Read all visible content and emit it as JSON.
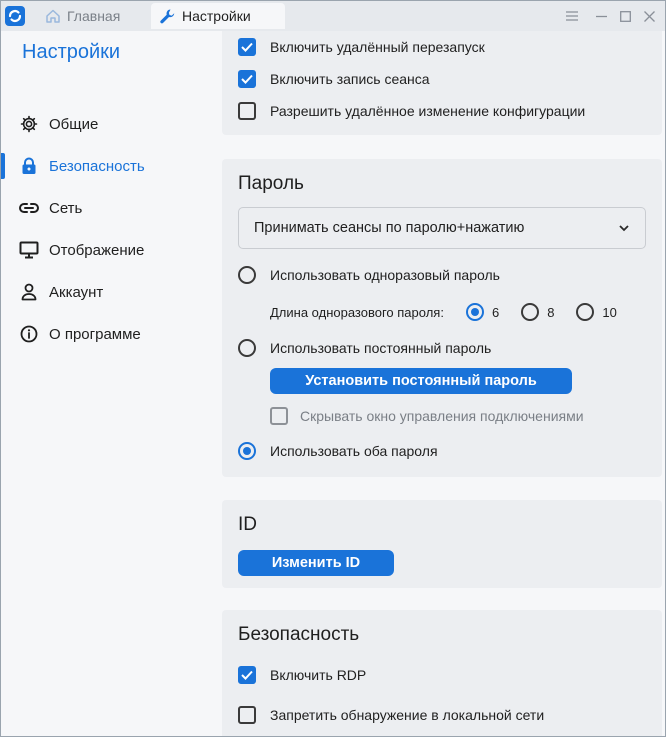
{
  "titlebar": {
    "tabs": [
      {
        "label": "Главная"
      },
      {
        "label": "Настройки"
      }
    ]
  },
  "sidebar": {
    "title": "Настройки",
    "items": [
      {
        "label": "Общие",
        "icon": "gear-icon"
      },
      {
        "label": "Безопасность",
        "icon": "lock-icon"
      },
      {
        "label": "Сеть",
        "icon": "link-icon"
      },
      {
        "label": "Отображение",
        "icon": "monitor-icon"
      },
      {
        "label": "Аккаунт",
        "icon": "user-icon"
      },
      {
        "label": "О программе",
        "icon": "info-icon"
      }
    ],
    "active_index": 1
  },
  "permissions": {
    "items": [
      {
        "label": "Включить удалённый перезапуск",
        "checked": true
      },
      {
        "label": "Включить запись сеанса",
        "checked": true
      },
      {
        "label": "Разрешить удалённое изменение конфигурации",
        "checked": false
      }
    ]
  },
  "password": {
    "title": "Пароль",
    "mode_select": "Принимать сеансы по паролю+нажатию",
    "one_time": "Использовать одноразовый пароль",
    "length_label": "Длина одноразового пароля:",
    "length_options": [
      "6",
      "8",
      "10"
    ],
    "length_selected": "6",
    "permanent": "Использовать постоянный пароль",
    "set_permanent_button": "Установить постоянный пароль",
    "hide_cm": "Скрывать окно управления подключениями",
    "both": "Использовать оба пароля",
    "selected_mode": "both"
  },
  "id_card": {
    "title": "ID",
    "change_button": "Изменить ID"
  },
  "security": {
    "title": "Безопасность",
    "items": [
      {
        "label": "Включить RDP",
        "checked": true
      },
      {
        "label": "Запретить обнаружение в локальной сети",
        "checked": false
      }
    ]
  },
  "colors": {
    "accent": "#1a73d9"
  }
}
